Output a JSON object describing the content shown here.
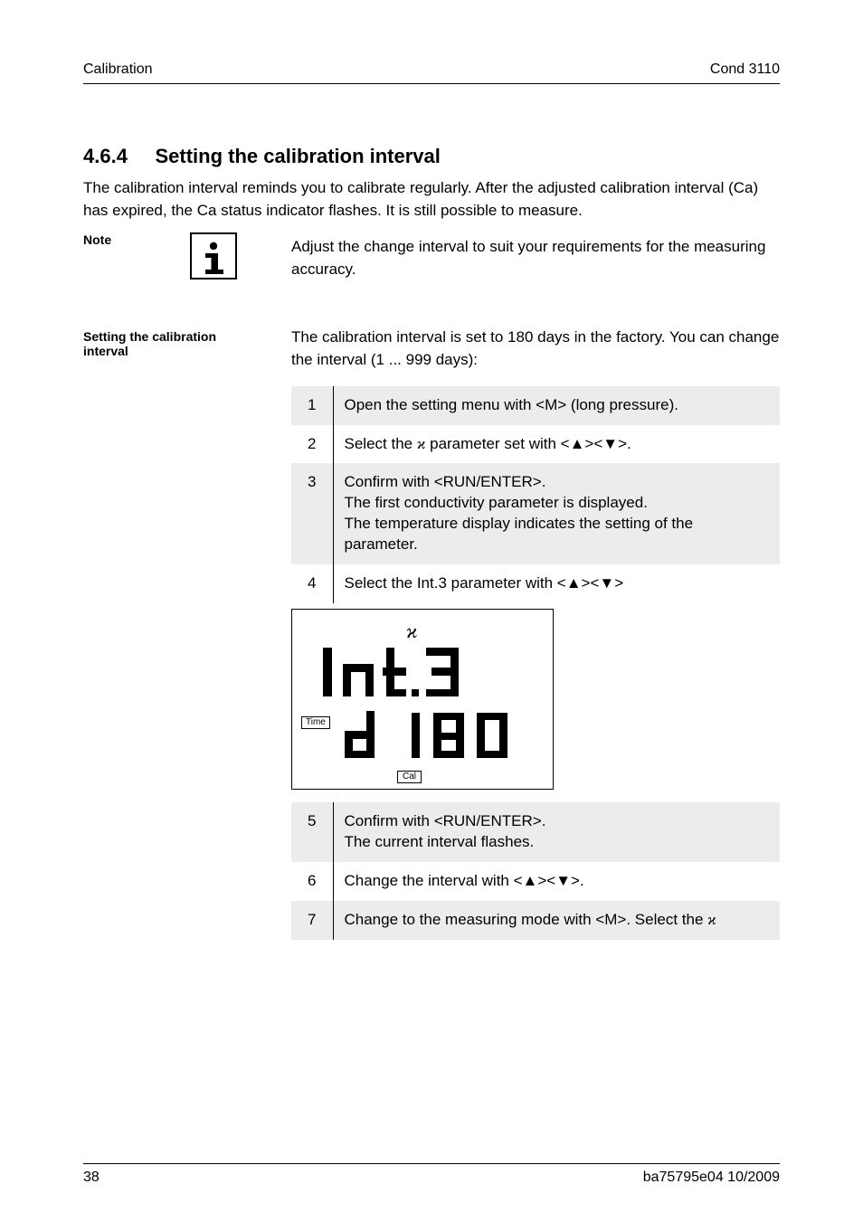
{
  "header": {
    "left": "Calibration",
    "right": "Cond 3110"
  },
  "section": {
    "number": "4.6.4",
    "title": "Setting the calibration interval"
  },
  "intro": "The calibration interval reminds you to calibrate regularly. After the adjusted calibration interval (Ca) has expired, the Ca status indicator flashes. It is still possible to measure.",
  "note_label": "Note",
  "note_text": "Adjust the change interval to suit your requirements for the measuring accuracy.",
  "side2_label": "Setting the calibration interval",
  "side2_text": "The calibration interval is set to 180 days in the factory. You can change the interval (1 ... 999 days):",
  "steps": [
    {
      "n": "1",
      "text": "Open the setting menu with <M> (long pressure)."
    },
    {
      "n": "2",
      "text_pre": "Select the ",
      "kappa": "ϰ",
      "text_post": " parameter set with <▲><▼>."
    },
    {
      "n": "3",
      "html": "Confirm with <span class='sc'>&lt;RUN/ENTER&gt;</span>.<br>The first conductivity parameter is displayed.<br>The temperature display indicates the setting of the parameter."
    },
    {
      "n": "4",
      "text": "Select the Int.3 parameter with <▲><▼>"
    }
  ],
  "lcd": {
    "kappa": "ϰ",
    "time": "Time",
    "ca": "Cal",
    "line1": "Int.3",
    "line2": "d 180"
  },
  "steps2": [
    {
      "n": "5",
      "html": "Confirm with <span class='sc'>&lt;RUN/ENTER&gt;</span>.<br>The current interval flashes."
    },
    {
      "n": "6",
      "text": "Change the interval with <▲><▼>."
    },
    {
      "n": "7",
      "text_pre": "Change to the measuring mode with <M>. Select the ",
      "kappa": "ϰ",
      "text_post": ""
    }
  ],
  "footer": {
    "left": "38",
    "right": "ba75795e04     10/2009"
  }
}
